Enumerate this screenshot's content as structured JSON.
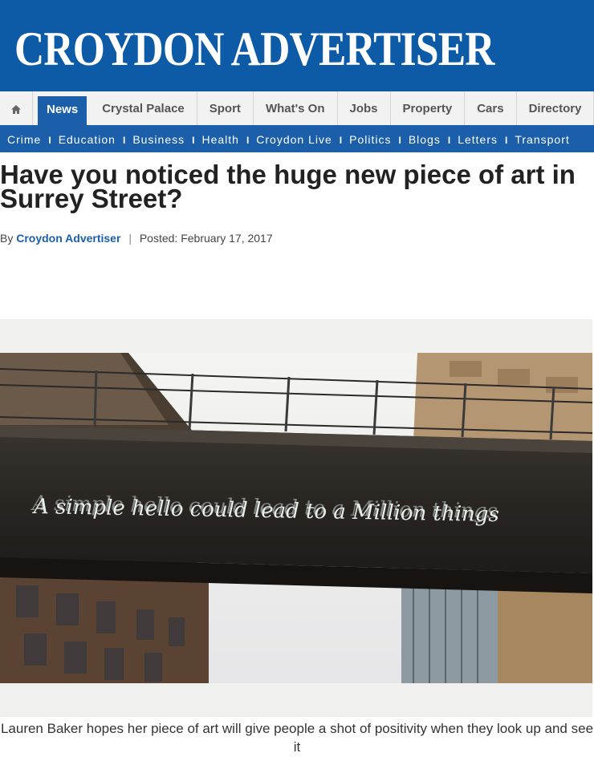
{
  "masthead": {
    "title": "CROYDON ADVERTISER"
  },
  "main_nav": {
    "home_icon": "home-icon",
    "items": [
      {
        "label": "News",
        "active": true
      },
      {
        "label": "Crystal Palace"
      },
      {
        "label": "Sport"
      },
      {
        "label": "What's On"
      },
      {
        "label": "Jobs"
      },
      {
        "label": "Property"
      },
      {
        "label": "Cars"
      },
      {
        "label": "Directory"
      }
    ]
  },
  "sub_nav": {
    "items": [
      "Crime",
      "Education",
      "Business",
      "Health",
      "Croydon Live",
      "Politics",
      "Blogs",
      "Letters",
      "Transport"
    ]
  },
  "article": {
    "headline": "Have you noticed the huge new piece of art in Surrey Street?",
    "byline_prefix": "By",
    "author": "Croydon Advertiser",
    "separator": "|",
    "posted": "Posted: February 17, 2017",
    "image_text": "A simple hello could lead to a Million things",
    "caption": "Lauren Baker hopes her piece of art will give people a shot of positivity when they look up and see it"
  },
  "colors": {
    "brand_blue": "#0d5aa7",
    "nav_blue": "#1b5eaa",
    "nav_bg": "#f2f2f2"
  }
}
